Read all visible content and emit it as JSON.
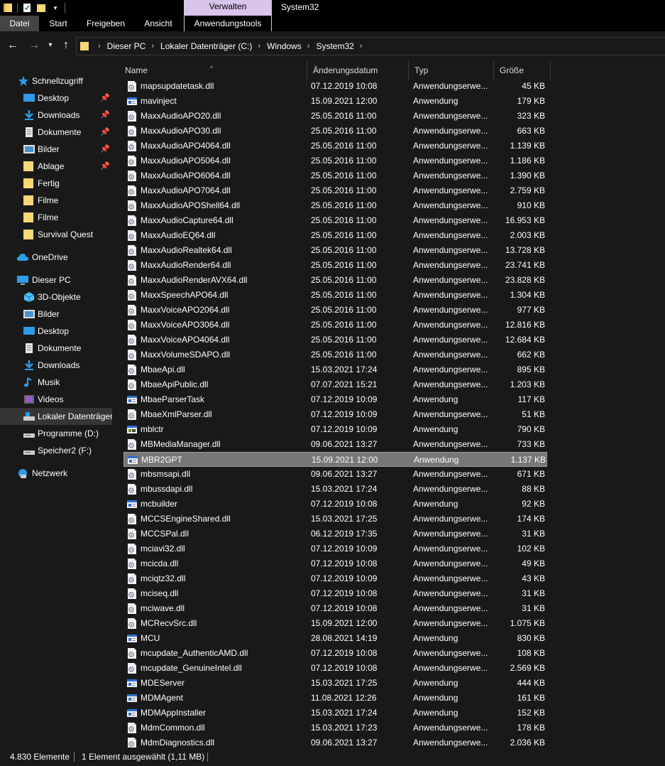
{
  "window": {
    "title": "System32",
    "context_group": "Verwalten"
  },
  "ribbon": {
    "tabs": [
      "Datei",
      "Start",
      "Freigeben",
      "Ansicht",
      "Anwendungstools"
    ]
  },
  "address": {
    "crumbs": [
      "Dieser PC",
      "Lokaler Datenträger (C:)",
      "Windows",
      "System32"
    ]
  },
  "sidebar": {
    "quick_access": "Schnellzugriff",
    "quick_items": [
      {
        "label": "Desktop",
        "icon": "desktop-icon",
        "pinned": true
      },
      {
        "label": "Downloads",
        "icon": "downloads-icon",
        "pinned": true
      },
      {
        "label": "Dokumente",
        "icon": "documents-icon",
        "pinned": true
      },
      {
        "label": "Bilder",
        "icon": "pictures-icon",
        "pinned": true
      },
      {
        "label": "Ablage",
        "icon": "folder-icon",
        "pinned": true
      },
      {
        "label": "Fertig",
        "icon": "folder-icon",
        "pinned": false
      },
      {
        "label": "Filme",
        "icon": "folder-icon",
        "pinned": false
      },
      {
        "label": "Filme",
        "icon": "folder-icon",
        "pinned": false
      },
      {
        "label": "Survival Quest",
        "icon": "folder-icon",
        "pinned": false
      }
    ],
    "onedrive": "OneDrive",
    "this_pc": "Dieser PC",
    "pc_items": [
      {
        "label": "3D-Objekte",
        "icon": "3d-objects-icon"
      },
      {
        "label": "Bilder",
        "icon": "pictures-icon"
      },
      {
        "label": "Desktop",
        "icon": "desktop-icon"
      },
      {
        "label": "Dokumente",
        "icon": "documents-icon"
      },
      {
        "label": "Downloads",
        "icon": "downloads-icon"
      },
      {
        "label": "Musik",
        "icon": "music-icon"
      },
      {
        "label": "Videos",
        "icon": "videos-icon"
      },
      {
        "label": "Lokaler Datenträger",
        "icon": "drive-icon"
      },
      {
        "label": "Programme (D:)",
        "icon": "drive-icon"
      },
      {
        "label": "Speicher2 (F:)",
        "icon": "drive-icon"
      }
    ],
    "network": "Netzwerk"
  },
  "columns": {
    "name": "Name",
    "date": "Änderungsdatum",
    "type": "Typ",
    "size": "Größe"
  },
  "files": [
    {
      "name": "mapsupdatetask.dll",
      "date": "07.12.2019 10:08",
      "type": "Anwendungserwe...",
      "size": "45 KB",
      "kind": "dll"
    },
    {
      "name": "mavinject",
      "date": "15.09.2021 12:00",
      "type": "Anwendung",
      "size": "179 KB",
      "kind": "exe"
    },
    {
      "name": "MaxxAudioAPO20.dll",
      "date": "25.05.2016 11:00",
      "type": "Anwendungserwe...",
      "size": "323 KB",
      "kind": "dll"
    },
    {
      "name": "MaxxAudioAPO30.dll",
      "date": "25.05.2016 11:00",
      "type": "Anwendungserwe...",
      "size": "663 KB",
      "kind": "dll"
    },
    {
      "name": "MaxxAudioAPO4064.dll",
      "date": "25.05.2016 11:00",
      "type": "Anwendungserwe...",
      "size": "1.139 KB",
      "kind": "dll"
    },
    {
      "name": "MaxxAudioAPO5064.dll",
      "date": "25.05.2016 11:00",
      "type": "Anwendungserwe...",
      "size": "1.186 KB",
      "kind": "dll"
    },
    {
      "name": "MaxxAudioAPO6064.dll",
      "date": "25.05.2016 11:00",
      "type": "Anwendungserwe...",
      "size": "1.390 KB",
      "kind": "dll"
    },
    {
      "name": "MaxxAudioAPO7064.dll",
      "date": "25.05.2016 11:00",
      "type": "Anwendungserwe...",
      "size": "2.759 KB",
      "kind": "dll"
    },
    {
      "name": "MaxxAudioAPOShell64.dll",
      "date": "25.05.2016 11:00",
      "type": "Anwendungserwe...",
      "size": "910 KB",
      "kind": "dll"
    },
    {
      "name": "MaxxAudioCapture64.dll",
      "date": "25.05.2016 11:00",
      "type": "Anwendungserwe...",
      "size": "16.953 KB",
      "kind": "dll"
    },
    {
      "name": "MaxxAudioEQ64.dll",
      "date": "25.05.2016 11:00",
      "type": "Anwendungserwe...",
      "size": "2.003 KB",
      "kind": "dll"
    },
    {
      "name": "MaxxAudioRealtek64.dll",
      "date": "25.05.2016 11:00",
      "type": "Anwendungserwe...",
      "size": "13.728 KB",
      "kind": "dll"
    },
    {
      "name": "MaxxAudioRender64.dll",
      "date": "25.05.2016 11:00",
      "type": "Anwendungserwe...",
      "size": "23.741 KB",
      "kind": "dll"
    },
    {
      "name": "MaxxAudioRenderAVX64.dll",
      "date": "25.05.2016 11:00",
      "type": "Anwendungserwe...",
      "size": "23.828 KB",
      "kind": "dll"
    },
    {
      "name": "MaxxSpeechAPO64.dll",
      "date": "25.05.2016 11:00",
      "type": "Anwendungserwe...",
      "size": "1.304 KB",
      "kind": "dll"
    },
    {
      "name": "MaxxVoiceAPO2064.dll",
      "date": "25.05.2016 11:00",
      "type": "Anwendungserwe...",
      "size": "977 KB",
      "kind": "dll"
    },
    {
      "name": "MaxxVoiceAPO3064.dll",
      "date": "25.05.2016 11:00",
      "type": "Anwendungserwe...",
      "size": "12.816 KB",
      "kind": "dll"
    },
    {
      "name": "MaxxVoiceAPO4064.dll",
      "date": "25.05.2016 11:00",
      "type": "Anwendungserwe...",
      "size": "12.684 KB",
      "kind": "dll"
    },
    {
      "name": "MaxxVolumeSDAPO.dll",
      "date": "25.05.2016 11:00",
      "type": "Anwendungserwe...",
      "size": "662 KB",
      "kind": "dll"
    },
    {
      "name": "MbaeApi.dll",
      "date": "15.03.2021 17:24",
      "type": "Anwendungserwe...",
      "size": "895 KB",
      "kind": "dll"
    },
    {
      "name": "MbaeApiPublic.dll",
      "date": "07.07.2021 15:21",
      "type": "Anwendungserwe...",
      "size": "1.203 KB",
      "kind": "dll"
    },
    {
      "name": "MbaeParserTask",
      "date": "07.12.2019 10:09",
      "type": "Anwendung",
      "size": "117 KB",
      "kind": "exe"
    },
    {
      "name": "MbaeXmlParser.dll",
      "date": "07.12.2019 10:09",
      "type": "Anwendungserwe...",
      "size": "51 KB",
      "kind": "dll"
    },
    {
      "name": "mblctr",
      "date": "07.12.2019 10:09",
      "type": "Anwendung",
      "size": "790 KB",
      "kind": "mblctr"
    },
    {
      "name": "MBMediaManager.dll",
      "date": "09.06.2021 13:27",
      "type": "Anwendungserwe...",
      "size": "733 KB",
      "kind": "dll"
    },
    {
      "name": "MBR2GPT",
      "date": "15.09.2021 12:00",
      "type": "Anwendung",
      "size": "1.137 KB",
      "kind": "exe",
      "selected": true
    },
    {
      "name": "mbsmsapi.dll",
      "date": "09.06.2021 13:27",
      "type": "Anwendungserwe...",
      "size": "671 KB",
      "kind": "dll"
    },
    {
      "name": "mbussdapi.dll",
      "date": "15.03.2021 17:24",
      "type": "Anwendungserwe...",
      "size": "88 KB",
      "kind": "dll"
    },
    {
      "name": "mcbuilder",
      "date": "07.12.2019 10:08",
      "type": "Anwendung",
      "size": "92 KB",
      "kind": "exe"
    },
    {
      "name": "MCCSEngineShared.dll",
      "date": "15.03.2021 17:25",
      "type": "Anwendungserwe...",
      "size": "174 KB",
      "kind": "dll"
    },
    {
      "name": "MCCSPal.dll",
      "date": "06.12.2019 17:35",
      "type": "Anwendungserwe...",
      "size": "31 KB",
      "kind": "dll"
    },
    {
      "name": "mciavi32.dll",
      "date": "07.12.2019 10:09",
      "type": "Anwendungserwe...",
      "size": "102 KB",
      "kind": "dll"
    },
    {
      "name": "mcicda.dll",
      "date": "07.12.2019 10:08",
      "type": "Anwendungserwe...",
      "size": "49 KB",
      "kind": "dll"
    },
    {
      "name": "mciqtz32.dll",
      "date": "07.12.2019 10:09",
      "type": "Anwendungserwe...",
      "size": "43 KB",
      "kind": "dll"
    },
    {
      "name": "mciseq.dll",
      "date": "07.12.2019 10:08",
      "type": "Anwendungserwe...",
      "size": "31 KB",
      "kind": "dll"
    },
    {
      "name": "mciwave.dll",
      "date": "07.12.2019 10:08",
      "type": "Anwendungserwe...",
      "size": "31 KB",
      "kind": "dll"
    },
    {
      "name": "MCRecvSrc.dll",
      "date": "15.09.2021 12:00",
      "type": "Anwendungserwe...",
      "size": "1.075 KB",
      "kind": "dll"
    },
    {
      "name": "MCU",
      "date": "28.08.2021 14:19",
      "type": "Anwendung",
      "size": "830 KB",
      "kind": "exe"
    },
    {
      "name": "mcupdate_AuthenticAMD.dll",
      "date": "07.12.2019 10:08",
      "type": "Anwendungserwe...",
      "size": "108 KB",
      "kind": "dll"
    },
    {
      "name": "mcupdate_GenuineIntel.dll",
      "date": "07.12.2019 10:08",
      "type": "Anwendungserwe...",
      "size": "2.569 KB",
      "kind": "dll"
    },
    {
      "name": "MDEServer",
      "date": "15.03.2021 17:25",
      "type": "Anwendung",
      "size": "444 KB",
      "kind": "exe"
    },
    {
      "name": "MDMAgent",
      "date": "11.08.2021 12:26",
      "type": "Anwendung",
      "size": "161 KB",
      "kind": "exe"
    },
    {
      "name": "MDMAppInstaller",
      "date": "15.03.2021 17:24",
      "type": "Anwendung",
      "size": "152 KB",
      "kind": "exe"
    },
    {
      "name": "MdmCommon.dll",
      "date": "15.03.2021 17:23",
      "type": "Anwendungserwe...",
      "size": "178 KB",
      "kind": "dll"
    },
    {
      "name": "MdmDiagnostics.dll",
      "date": "09.06.2021 13:27",
      "type": "Anwendungserwe...",
      "size": "2.036 KB",
      "kind": "dll"
    }
  ],
  "status": {
    "count": "4.830 Elemente",
    "selected": "1 Element ausgewählt (1,11 MB)"
  },
  "colors": {
    "background": "#191919",
    "selection": "#777777",
    "context_tab": "#d9c4ec",
    "folder_yellow": "#f8d775",
    "accent_blue": "#2f9be8"
  }
}
